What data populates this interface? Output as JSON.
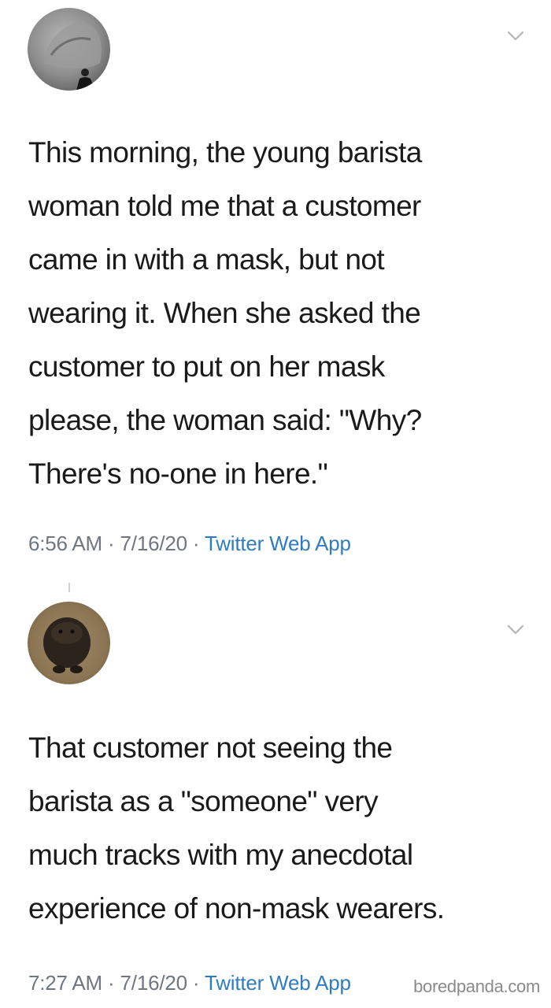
{
  "tweets": [
    {
      "avatar_icon": "avatar-icon",
      "menu_icon": "chevron-down-icon",
      "lines": [
        "This morning, the young barista",
        "woman told me that a customer",
        "came in with a mask, but not",
        "wearing it. When she asked the",
        "customer to put on her mask",
        "please, the woman said: \"Why?",
        "There's no-one in here.\""
      ],
      "time": "6:56 AM",
      "date": "7/16/20",
      "separator": "·",
      "source": "Twitter Web App"
    },
    {
      "avatar_icon": "avatar-icon",
      "menu_icon": "chevron-down-icon",
      "lines": [
        "That customer not seeing the",
        "barista as a \"someone\" very",
        "much tracks with my anecdotal",
        "experience of non-mask wearers."
      ],
      "time": "7:27 AM",
      "date": "7/16/20",
      "separator": "·",
      "source": "Twitter Web App"
    }
  ],
  "watermark": "boredpanda.com",
  "colors": {
    "text": "#1a1a1a",
    "meta": "#6e7781",
    "link": "#2f7cc2",
    "background": "#ffffff"
  }
}
